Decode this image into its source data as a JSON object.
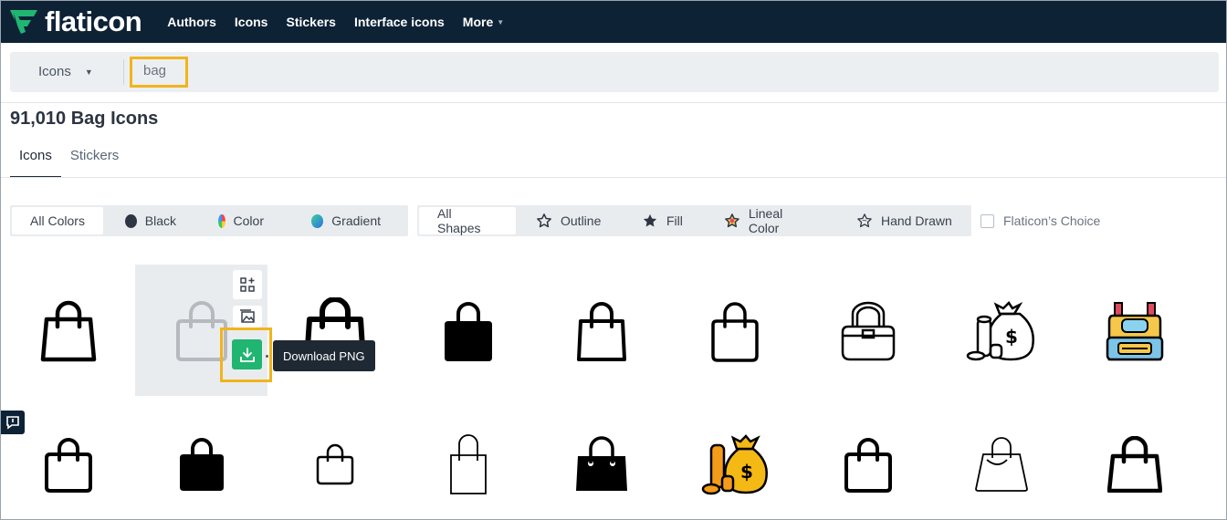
{
  "brand": {
    "name": "flaticon",
    "accent": "#21b572",
    "navbar_bg": "#0e2236"
  },
  "nav": {
    "items": [
      "Authors",
      "Icons",
      "Stickers",
      "Interface icons"
    ],
    "more": "More"
  },
  "search": {
    "type_label": "Icons",
    "query": "bag"
  },
  "results": {
    "title": "91,010 Bag Icons"
  },
  "tabs": [
    {
      "label": "Icons",
      "active": true
    },
    {
      "label": "Stickers",
      "active": false
    }
  ],
  "color_filters": [
    {
      "label": "All Colors",
      "icon": "none",
      "active": true
    },
    {
      "label": "Black",
      "icon": "black-dot",
      "active": false
    },
    {
      "label": "Color",
      "icon": "color-wheel",
      "active": false
    },
    {
      "label": "Gradient",
      "icon": "gradient-dot",
      "active": false
    }
  ],
  "shape_filters": [
    {
      "label": "All Shapes",
      "icon": "none",
      "active": true
    },
    {
      "label": "Outline",
      "icon": "star-outline-icon",
      "active": false
    },
    {
      "label": "Fill",
      "icon": "star-fill-icon",
      "active": false
    },
    {
      "label": "Lineal Color",
      "icon": "star-color-icon",
      "active": false
    },
    {
      "label": "Hand Drawn",
      "icon": "star-hand-icon",
      "active": false
    }
  ],
  "choice_filter": {
    "label": "Flaticon’s Choice",
    "checked": false
  },
  "hover": {
    "tooltip": "Download PNG"
  },
  "icons_row1": [
    "bag-outline",
    "bag-outline-hovered",
    "bag-bold-outline",
    "bag-fill",
    "bag-outline",
    "bag-outline-rounded",
    "handbag-outline",
    "money-bag-outline",
    "backpack-color"
  ],
  "icons_row2": [
    "bag-outline",
    "bag-fill",
    "bag-small-outline",
    "bag-thin-outline",
    "bag-fill-dots",
    "money-bag-color",
    "bag-outline",
    "bag-outline-thin",
    "bag-outline"
  ]
}
